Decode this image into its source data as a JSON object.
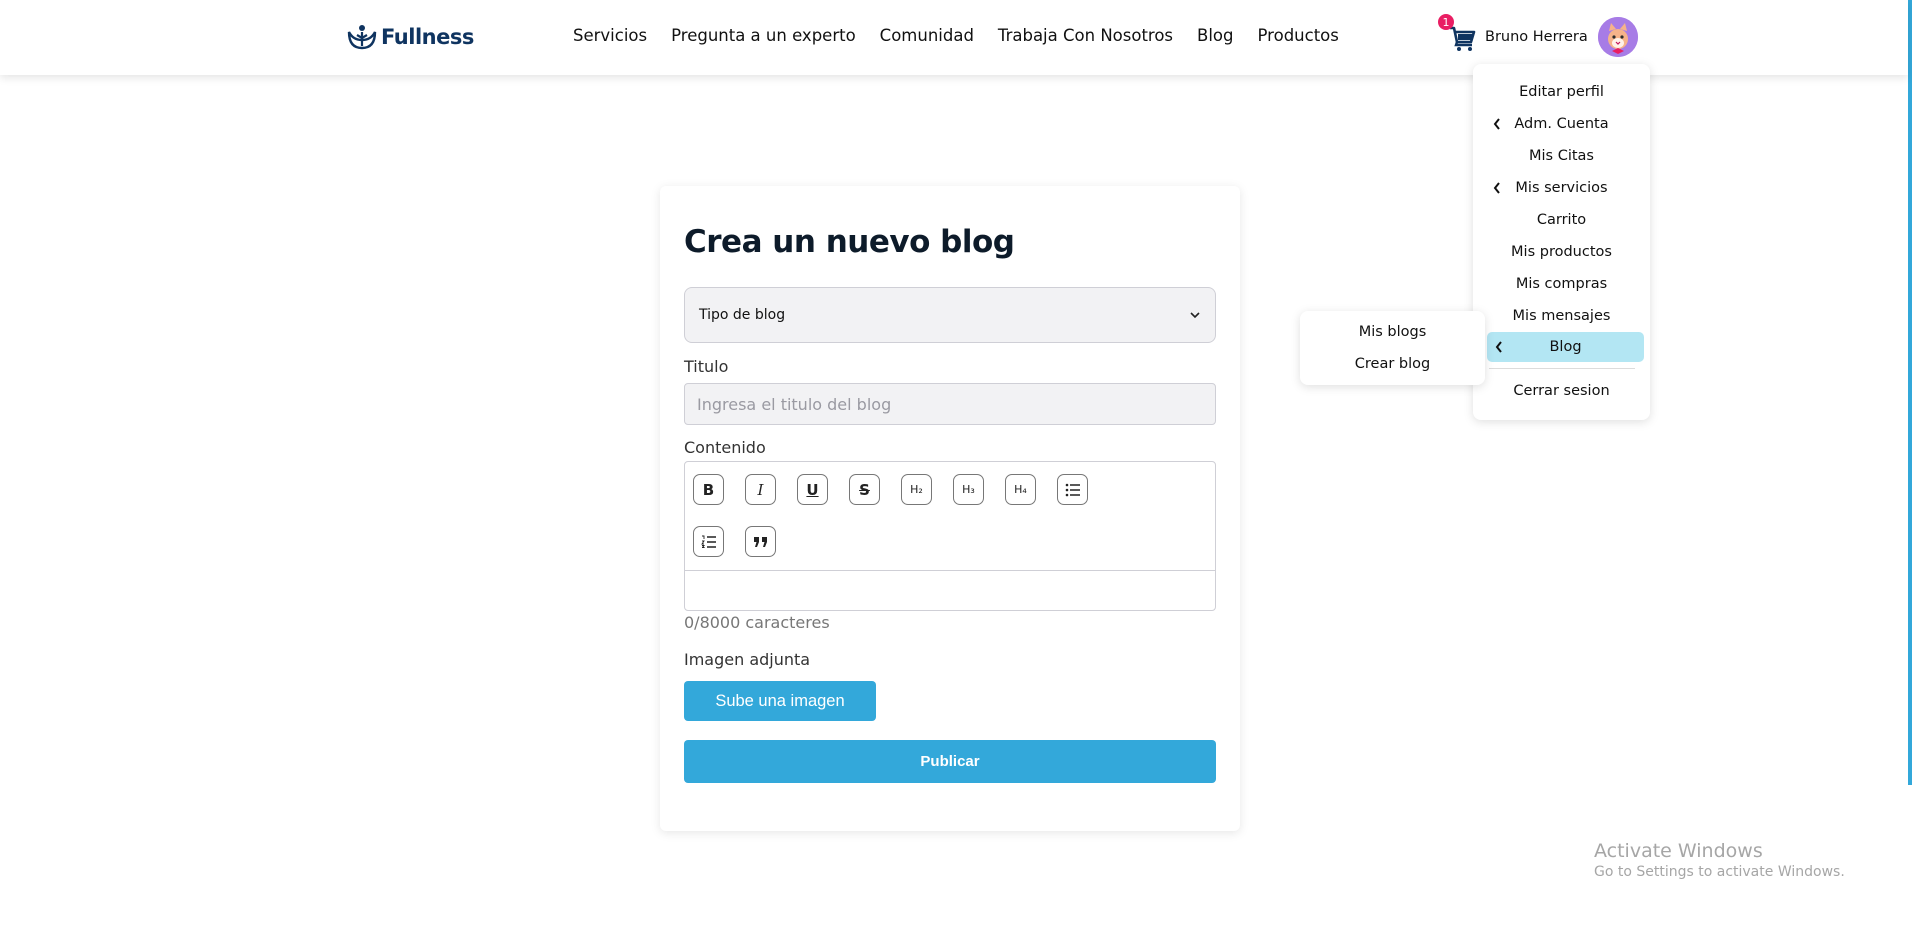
{
  "brand": {
    "name": "Fullness",
    "color": "#0f3460"
  },
  "nav": {
    "links": [
      "Servicios",
      "Pregunta a un experto",
      "Comunidad",
      "Trabaja Con Nosotros",
      "Blog",
      "Productos"
    ]
  },
  "header": {
    "cart_icon": "shopping-cart-icon",
    "cart_count": "1",
    "user_name": "Bruno Herrera",
    "avatar_icon": "cat-avatar-icon"
  },
  "form": {
    "title": "Crea un nuevo blog",
    "blog_type_placeholder": "Tipo de blog",
    "title_label": "Titulo",
    "title_placeholder": "Ingresa el titulo del blog",
    "content_label": "Contenido",
    "toolbar": [
      "bold-icon",
      "italic-icon",
      "underline-icon",
      "strikethrough-icon",
      "heading-2-icon",
      "heading-3-icon",
      "heading-4-icon",
      "bullet-list-icon",
      "ordered-list-icon",
      "blockquote-icon"
    ],
    "toolbar_labels": {
      "bold": "B",
      "italic": "I",
      "underline": "U",
      "strike": "S",
      "h2": "H₂",
      "h3": "H₃",
      "h4": "H₄"
    },
    "char_count": "0/8000 caracteres",
    "image_label": "Imagen adjunta",
    "upload_button": "Sube una imagen",
    "publish_button": "Publicar"
  },
  "user_menu": {
    "items": [
      "Editar perfil",
      "Adm. Cuenta",
      "Mis Citas",
      "Mis servicios",
      "Carrito",
      "Mis productos",
      "Mis compras",
      "Mis mensajes",
      "Blog"
    ],
    "logout": "Cerrar sesion",
    "active_item": "Blog"
  },
  "blog_submenu": {
    "items": [
      "Mis blogs",
      "Crear blog"
    ]
  },
  "windows_watermark": {
    "title": "Activate Windows",
    "subtitle": "Go to Settings to activate Windows."
  },
  "colors": {
    "accent": "#33a8da",
    "active_menu_bg": "#b3e6f3",
    "badge": "#e91e63",
    "input_bg": "#f2f2f4"
  }
}
